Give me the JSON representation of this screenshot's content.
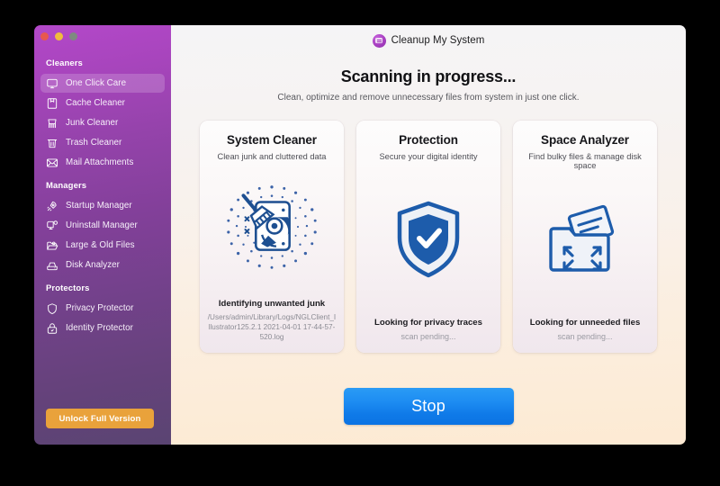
{
  "window": {
    "traffic_lights": [
      {
        "name": "close",
        "color": "#e8584f"
      },
      {
        "name": "minimize",
        "color": "#f0bd3d"
      },
      {
        "name": "zoom",
        "color": "#7e8a80"
      }
    ]
  },
  "sidebar": {
    "groups": [
      {
        "title": "Cleaners",
        "items": [
          {
            "label": "One Click Care",
            "icon": "monitor-icon",
            "active": true
          },
          {
            "label": "Cache Cleaner",
            "icon": "cache-box-icon",
            "active": false
          },
          {
            "label": "Junk Cleaner",
            "icon": "brush-icon",
            "active": false
          },
          {
            "label": "Trash Cleaner",
            "icon": "trash-bin-icon",
            "active": false
          },
          {
            "label": "Mail Attachments",
            "icon": "envelope-icon",
            "active": false
          }
        ]
      },
      {
        "title": "Managers",
        "items": [
          {
            "label": "Startup Manager",
            "icon": "rocket-icon",
            "active": false
          },
          {
            "label": "Uninstall Manager",
            "icon": "monitor-gear-icon",
            "active": false
          },
          {
            "label": "Large & Old Files",
            "icon": "folder-clock-icon",
            "active": false
          },
          {
            "label": "Disk Analyzer",
            "icon": "hard-drive-icon",
            "active": false
          }
        ]
      },
      {
        "title": "Protectors",
        "items": [
          {
            "label": "Privacy Protector",
            "icon": "shield-outline-icon",
            "active": false
          },
          {
            "label": "Identity Protector",
            "icon": "lock-icon",
            "active": false
          }
        ]
      }
    ],
    "unlock_button": "Unlock Full Version",
    "unlock_color": "#e9a23b"
  },
  "header": {
    "logo_icon": "app-logo-icon",
    "app_title": "Cleanup My System"
  },
  "main": {
    "page_title": "Scanning in progress...",
    "page_subtitle": "Clean, optimize and remove unnecessary files from system in just one click.",
    "cards": [
      {
        "title": "System Cleaner",
        "subtitle": "Clean junk and cluttered data",
        "icon": "disk-broom-icon",
        "status": "Identifying unwanted junk",
        "detail": "/Users/admin/Library/Logs/NGLClient_Illustrator125.2.1 2021-04-01 17-44-57-520.log",
        "pending": false
      },
      {
        "title": "Protection",
        "subtitle": "Secure your digital identity",
        "icon": "shield-check-icon",
        "status": "Looking for privacy traces",
        "detail": "scan pending...",
        "pending": true
      },
      {
        "title": "Space Analyzer",
        "subtitle": "Find bulky files & manage disk space",
        "icon": "folder-expand-icon",
        "status": "Looking for unneeded files",
        "detail": "scan pending...",
        "pending": true
      }
    ],
    "stop_button": "Stop",
    "stop_color": "#1d8cf2"
  }
}
